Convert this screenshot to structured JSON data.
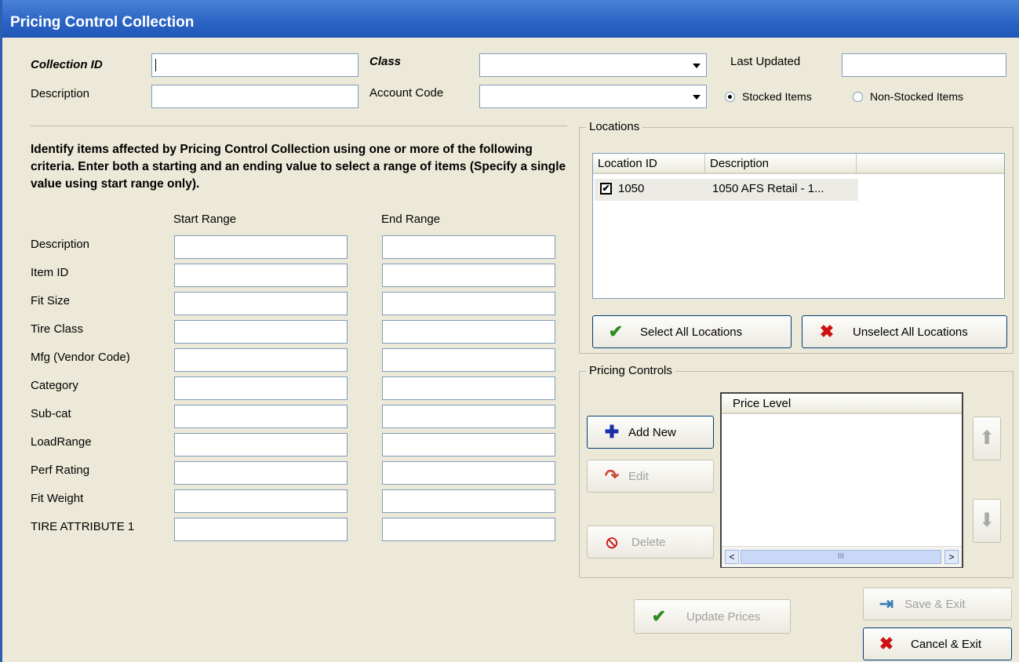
{
  "window": {
    "title": "Pricing Control Collection"
  },
  "header": {
    "collection_id_label": "Collection ID",
    "collection_id_value": "",
    "description_label": "Description",
    "description_value": "",
    "class_label": "Class",
    "class_value": "",
    "account_code_label": "Account Code",
    "account_code_value": "",
    "last_updated_label": "Last Updated",
    "last_updated_value": "",
    "stocked_label": "Stocked Items",
    "non_stocked_label": "Non-Stocked Items",
    "stock_selection": "Stocked Items"
  },
  "criteria": {
    "instructions": "Identify items affected by Pricing Control Collection using one or more of the following criteria.  Enter both a starting and an ending  value to select a range of items (Specify a single value using start range only).",
    "start_header": "Start Range",
    "end_header": "End Range",
    "rows": [
      {
        "label": "Description",
        "start": "",
        "end": ""
      },
      {
        "label": "Item ID",
        "start": "",
        "end": ""
      },
      {
        "label": "Fit Size",
        "start": "",
        "end": ""
      },
      {
        "label": "Tire Class",
        "start": "",
        "end": ""
      },
      {
        "label": "Mfg (Vendor Code)",
        "start": "",
        "end": ""
      },
      {
        "label": "Category",
        "start": "",
        "end": ""
      },
      {
        "label": "Sub-cat",
        "start": "",
        "end": ""
      },
      {
        "label": "LoadRange",
        "start": "",
        "end": ""
      },
      {
        "label": "Perf Rating",
        "start": "",
        "end": ""
      },
      {
        "label": "Fit Weight",
        "start": "",
        "end": ""
      },
      {
        "label": "TIRE ATTRIBUTE 1",
        "start": "",
        "end": ""
      }
    ]
  },
  "locations": {
    "group_title": "Locations",
    "columns": [
      "Location ID",
      "Description"
    ],
    "rows": [
      {
        "checked": true,
        "location_id": "1050",
        "description": "1050 AFS Retail - 1..."
      }
    ],
    "select_all": "Select All Locations",
    "unselect_all": "Unselect All Locations"
  },
  "pricing_controls": {
    "group_title": "Pricing Controls",
    "add_new": "Add New",
    "edit": "Edit",
    "delete": "Delete",
    "list_header": "Price Level",
    "scroll_mid": "III"
  },
  "footer": {
    "update_prices": "Update Prices",
    "save_exit": "Save & Exit",
    "cancel_exit": "Cancel & Exit"
  },
  "icons": {
    "check": "✔",
    "x": "✖",
    "add": "✚",
    "edit": "↷",
    "delete": "⦸",
    "up": "⬆",
    "down": "⬇",
    "save": "⇥"
  },
  "colors": {
    "title_bar": "#2a63c4",
    "check_green": "#2e8b1e",
    "x_red": "#cc1111"
  }
}
